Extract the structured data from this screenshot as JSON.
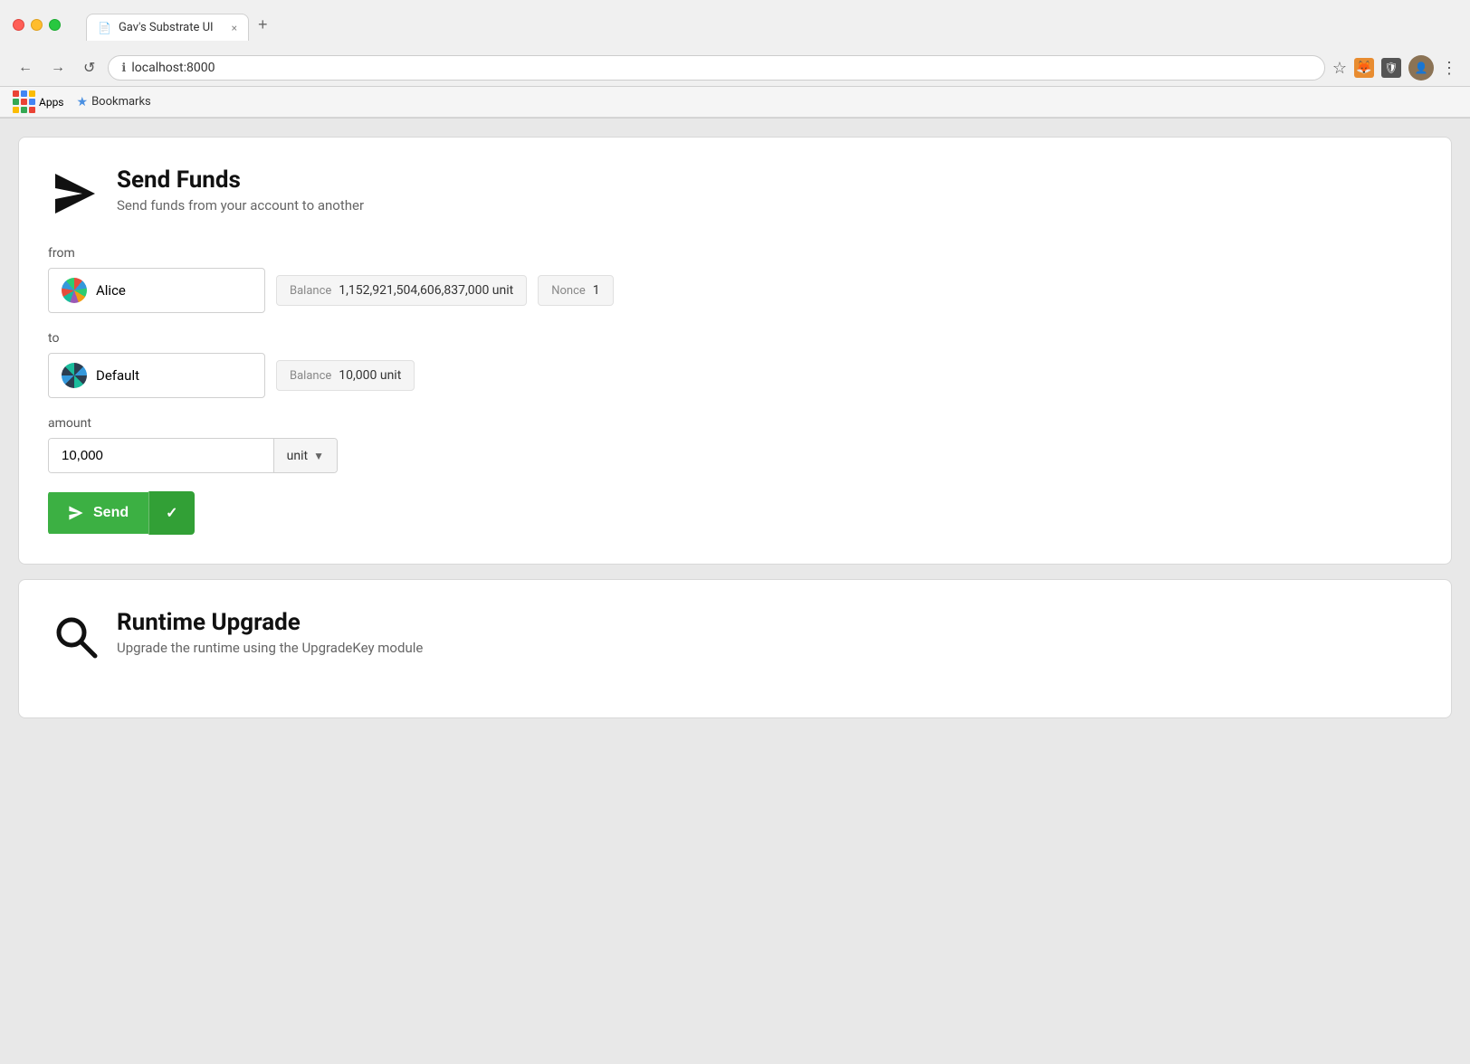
{
  "browser": {
    "tab_title": "Gav's Substrate UI",
    "tab_close": "×",
    "tab_new": "+",
    "address": "localhost:8000",
    "back_btn": "←",
    "forward_btn": "→",
    "refresh_btn": "↺",
    "menu_btn": "⋮",
    "star_btn": "☆",
    "bookmarks_label": "Bookmarks",
    "apps_label": "Apps"
  },
  "send_funds": {
    "title": "Send Funds",
    "subtitle": "Send funds from your account to another",
    "from_label": "from",
    "to_label": "to",
    "amount_label": "amount",
    "from_account": "Alice",
    "to_account": "Default",
    "balance_label": "Balance",
    "from_balance": "1,152,921,504,606,837,000 unit",
    "to_balance": "10,000 unit",
    "nonce_label": "Nonce",
    "nonce_value": "1",
    "amount_value": "10,000",
    "unit_label": "unit",
    "send_btn_label": "Send"
  },
  "runtime_upgrade": {
    "title": "Runtime Upgrade",
    "subtitle": "Upgrade the runtime using the UpgradeKey module"
  }
}
